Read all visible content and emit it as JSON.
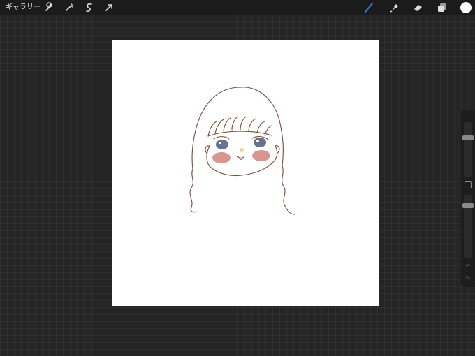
{
  "topbar": {
    "gallery_label": "ギャラリー",
    "left_tools": [
      "wrench-icon",
      "magic-wand-icon",
      "selection-icon",
      "transform-arrow-icon"
    ],
    "right_tools": [
      "brush-icon",
      "smudge-icon",
      "eraser-icon",
      "layers-icon"
    ],
    "active_tool": "brush-icon",
    "active_tool_color": "#2f6fd6",
    "current_color": "#ffffff"
  },
  "canvas": {
    "background": "#ffffff",
    "drawing": {
      "line_color": "#7a4a3a",
      "cheek_color": "#c9736c",
      "eye_color": "#4a5a78",
      "nose_color": "#e8d68a"
    }
  },
  "sidebar": {
    "brush_size": 0.13,
    "opacity": 0.14
  }
}
